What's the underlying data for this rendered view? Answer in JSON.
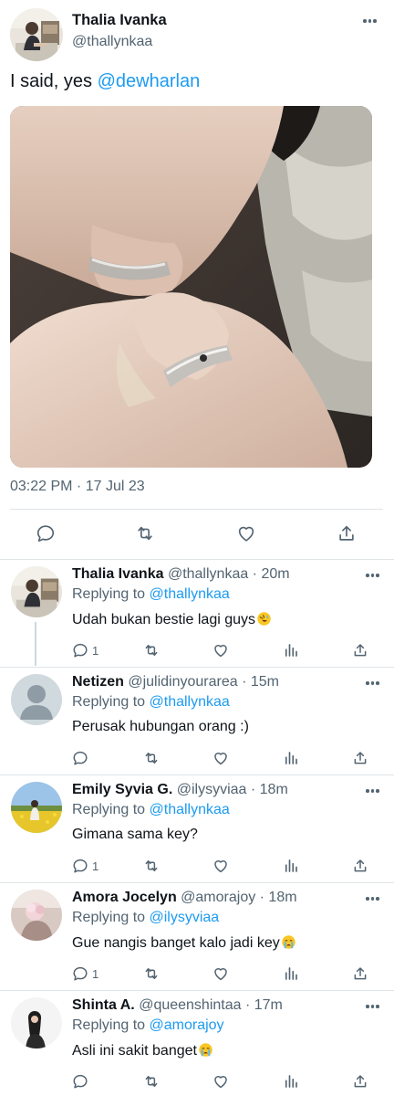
{
  "main_tweet": {
    "author_name": "Thalia Ivanka",
    "author_handle": "@thallynkaa",
    "text": "I said, yes ",
    "mention": "@dewharlan",
    "timestamp": "03:22 PM · 17 Jul 23",
    "actions": [
      "reply-icon",
      "retweet-icon",
      "like-icon",
      "share-icon"
    ]
  },
  "replies": [
    {
      "name": "Thalia Ivanka",
      "meta": " @thallynkaa · 20m",
      "replying_prefix": "Replying to ",
      "replying_to": "@thallynkaa",
      "text": "Udah bukan bestie lagi guys",
      "emoji": "rolling-on-floor-laughing",
      "reply_count": "1"
    },
    {
      "name": "Netizen",
      "meta": " @julidinyourarea · 15m",
      "replying_prefix": "Replying to ",
      "replying_to": "@thallynkaa",
      "text": "Perusak hubungan orang :)",
      "emoji": "",
      "reply_count": ""
    },
    {
      "name": "Emily Syvia G.",
      "meta": " @ilysyviaa · 18m",
      "replying_prefix": "Replying to ",
      "replying_to": "@thallynkaa",
      "text": "Gimana sama key?",
      "emoji": "",
      "reply_count": "1"
    },
    {
      "name": "Amora Jocelyn",
      "meta": " @amorajoy · 18m",
      "replying_prefix": "Replying to ",
      "replying_to": "@ilysyviaa",
      "text": "Gue nangis banget kalo jadi key",
      "emoji": "loudly-crying-face",
      "reply_count": "1"
    },
    {
      "name": "Shinta A.",
      "meta": " @queenshintaa · 17m",
      "replying_prefix": "Replying to ",
      "replying_to": "@amorajoy",
      "text": "Asli ini sakit banget",
      "emoji": "loudly-crying-face",
      "reply_count": ""
    }
  ],
  "colors": {
    "accent": "#1d9bf0",
    "secondary_text": "#536471",
    "divider": "#dfe4e8"
  }
}
